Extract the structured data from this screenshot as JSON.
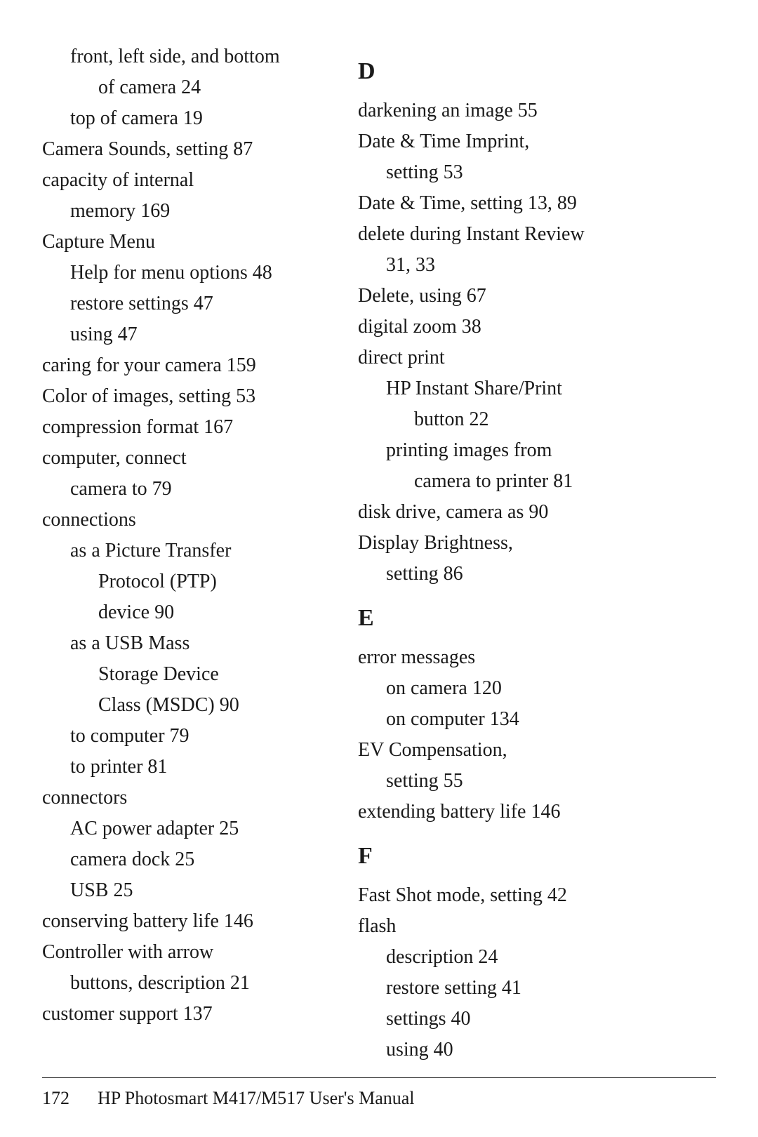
{
  "page": {
    "footer": {
      "page_number": "172",
      "title": "HP Photosmart M417/M517 User's Manual"
    }
  },
  "left_column": [
    {
      "type": "entry-sub1",
      "text": "front, left side, and bottom"
    },
    {
      "type": "entry-sub2",
      "text": "of camera  24"
    },
    {
      "type": "entry-sub1",
      "text": "top of camera  19"
    },
    {
      "type": "entry-main",
      "text": "Camera Sounds, setting  87"
    },
    {
      "type": "entry-main",
      "text": "capacity of internal"
    },
    {
      "type": "entry-sub1",
      "text": "memory  169"
    },
    {
      "type": "entry-main",
      "text": "Capture Menu"
    },
    {
      "type": "entry-sub1",
      "text": "Help for menu options  48"
    },
    {
      "type": "entry-sub1",
      "text": "restore settings  47"
    },
    {
      "type": "entry-sub1",
      "text": "using  47"
    },
    {
      "type": "entry-main",
      "text": "caring for your camera  159"
    },
    {
      "type": "entry-main",
      "text": "Color of images, setting  53"
    },
    {
      "type": "entry-main",
      "text": "compression format  167"
    },
    {
      "type": "entry-main",
      "text": "computer, connect"
    },
    {
      "type": "entry-sub1",
      "text": "camera to  79"
    },
    {
      "type": "entry-main",
      "text": "connections"
    },
    {
      "type": "entry-sub1",
      "text": "as a Picture Transfer"
    },
    {
      "type": "entry-sub2",
      "text": "Protocol (PTP)"
    },
    {
      "type": "entry-sub2",
      "text": "device  90"
    },
    {
      "type": "entry-sub1",
      "text": "as a USB Mass"
    },
    {
      "type": "entry-sub2",
      "text": "Storage Device"
    },
    {
      "type": "entry-sub2",
      "text": "Class (MSDC)  90"
    },
    {
      "type": "entry-sub1",
      "text": "to computer  79"
    },
    {
      "type": "entry-sub1",
      "text": "to printer  81"
    },
    {
      "type": "entry-main",
      "text": "connectors"
    },
    {
      "type": "entry-sub1",
      "text": "AC power adapter  25"
    },
    {
      "type": "entry-sub1",
      "text": "camera dock  25"
    },
    {
      "type": "entry-sub1",
      "text": "USB  25"
    },
    {
      "type": "entry-main",
      "text": "conserving battery life  146"
    },
    {
      "type": "entry-main",
      "text": "Controller with arrow"
    },
    {
      "type": "entry-sub1",
      "text": "buttons, description  21"
    },
    {
      "type": "entry-main",
      "text": "customer support  137"
    }
  ],
  "right_column": [
    {
      "type": "section-header",
      "text": "D"
    },
    {
      "type": "entry-main",
      "text": "darkening an image  55"
    },
    {
      "type": "entry-main",
      "text": "Date & Time Imprint,"
    },
    {
      "type": "entry-sub1",
      "text": "setting  53"
    },
    {
      "type": "entry-main",
      "text": "Date & Time, setting  13,  89"
    },
    {
      "type": "entry-main",
      "text": "delete during Instant Review"
    },
    {
      "type": "entry-sub1",
      "text": "31,  33"
    },
    {
      "type": "entry-main",
      "text": "Delete, using  67"
    },
    {
      "type": "entry-main",
      "text": "digital zoom  38"
    },
    {
      "type": "entry-main",
      "text": "direct print"
    },
    {
      "type": "entry-sub1",
      "text": "HP Instant Share/Print"
    },
    {
      "type": "entry-sub2",
      "text": "button  22"
    },
    {
      "type": "entry-sub1",
      "text": "printing images from"
    },
    {
      "type": "entry-sub2",
      "text": "camera to printer  81"
    },
    {
      "type": "entry-main",
      "text": "disk drive, camera as  90"
    },
    {
      "type": "entry-main",
      "text": "Display Brightness,"
    },
    {
      "type": "entry-sub1",
      "text": "setting  86"
    },
    {
      "type": "section-header",
      "text": "E"
    },
    {
      "type": "entry-main",
      "text": "error messages"
    },
    {
      "type": "entry-sub1",
      "text": "on camera  120"
    },
    {
      "type": "entry-sub1",
      "text": "on computer  134"
    },
    {
      "type": "entry-main",
      "text": "EV Compensation,"
    },
    {
      "type": "entry-sub1",
      "text": "setting  55"
    },
    {
      "type": "entry-main",
      "text": "extending battery life  146"
    },
    {
      "type": "section-header",
      "text": "F"
    },
    {
      "type": "entry-main",
      "text": "Fast Shot mode, setting  42"
    },
    {
      "type": "entry-main",
      "text": "flash"
    },
    {
      "type": "entry-sub1",
      "text": "description  24"
    },
    {
      "type": "entry-sub1",
      "text": "restore setting  41"
    },
    {
      "type": "entry-sub1",
      "text": "settings  40"
    },
    {
      "type": "entry-sub1",
      "text": "using  40"
    }
  ]
}
